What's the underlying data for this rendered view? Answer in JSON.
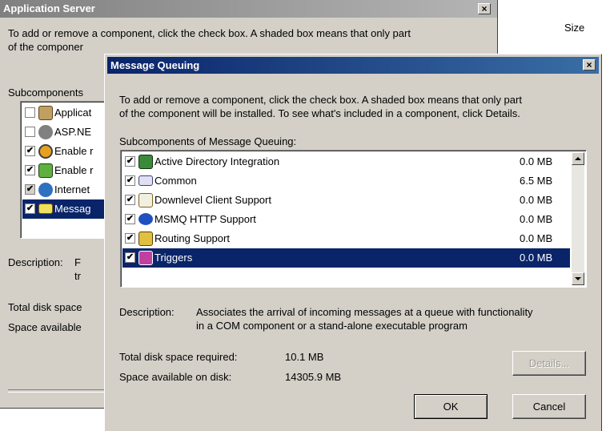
{
  "back_dialog": {
    "title": "Application Server",
    "intro_line1": "To add or remove a component, click the check box. A shaded box means that only part",
    "intro_line2": "of the componer",
    "subcomponents_label": "Subcomponents",
    "items": [
      {
        "label": "Applicat",
        "checked": false
      },
      {
        "label": "ASP.NE",
        "checked": false
      },
      {
        "label": "Enable r",
        "checked": true
      },
      {
        "label": "Enable r",
        "checked": true
      },
      {
        "label": "Internet",
        "checked": true
      },
      {
        "label": "Messag",
        "checked": true
      }
    ],
    "description_label": "Description:",
    "description_frag1": "F",
    "description_frag2": "tr",
    "total_label": "Total disk space",
    "available_label": "Space available"
  },
  "size_header": "Size",
  "dialog": {
    "title": "Message Queuing",
    "close_symbol": "×",
    "intro_line1": "To add or remove a component, click the check box. A shaded box means that only part",
    "intro_line2": "of the component will be installed. To see what's included in a component, click Details.",
    "subcomponents_label": "Subcomponents of Message Queuing:",
    "items": [
      {
        "label": "Active Directory Integration",
        "size": "0.0 MB",
        "checked": true,
        "icon": "directory-icon"
      },
      {
        "label": "Common",
        "size": "6.5 MB",
        "checked": true,
        "icon": "envelope-icon"
      },
      {
        "label": "Downlevel Client Support",
        "size": "0.0 MB",
        "checked": true,
        "icon": "calendar-icon"
      },
      {
        "label": "MSMQ HTTP Support",
        "size": "0.0 MB",
        "checked": true,
        "icon": "http-envelope-icon"
      },
      {
        "label": "Routing Support",
        "size": "0.0 MB",
        "checked": true,
        "icon": "routing-icon"
      },
      {
        "label": "Triggers",
        "size": "0.0 MB",
        "checked": true,
        "icon": "trigger-icon"
      }
    ],
    "description_label": "Description:",
    "description_line1": "Associates the arrival of incoming messages at a queue with functionality",
    "description_line2": "in a COM component or a stand-alone executable program",
    "total_label": "Total disk space required:",
    "total_value": "10.1 MB",
    "available_label": "Space available on disk:",
    "available_value": "14305.9 MB",
    "details_button": "Details...",
    "ok_button": "OK",
    "cancel_button": "Cancel"
  },
  "colors": {
    "title_active": "#0a246a",
    "title_inactive": "#808080",
    "selection": "#0a246a",
    "face": "#d4d0c8"
  }
}
